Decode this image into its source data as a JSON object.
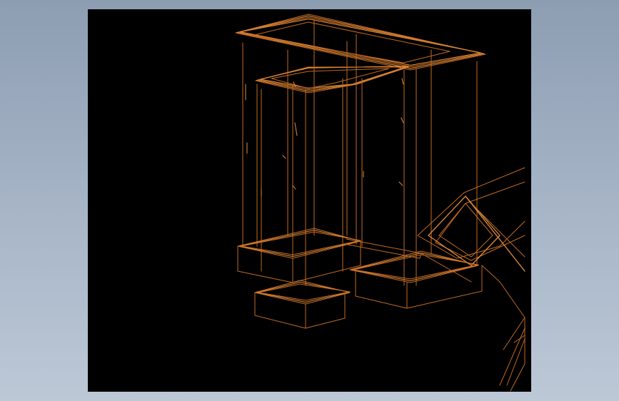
{
  "viewport": {
    "background_color": "#000000",
    "wire_color": "#c06a22",
    "wire_color_bright": "#e08a3a"
  },
  "page": {
    "background_color_top": "#8d9db2",
    "background_color_bottom": "#bcc8d6"
  }
}
